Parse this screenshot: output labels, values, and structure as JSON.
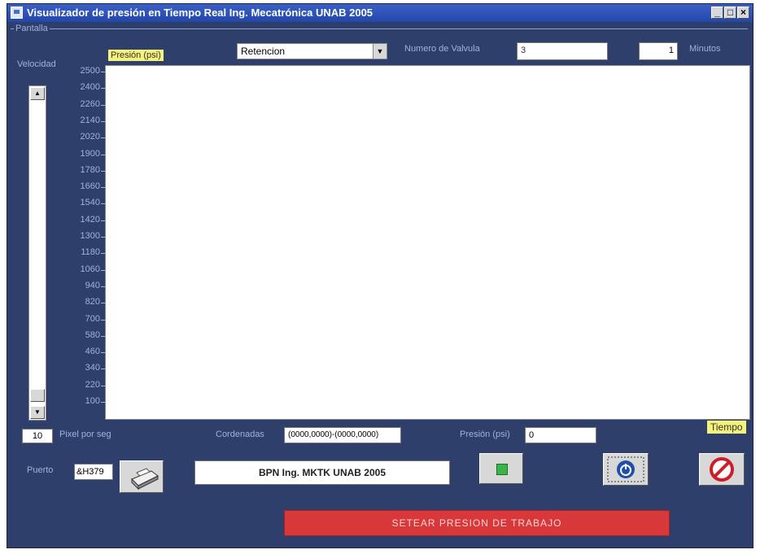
{
  "window": {
    "title": "Visualizador de presión en Tiempo Real Ing. Mecatrónica UNAB 2005",
    "frame_label": "Pantalla"
  },
  "controls": {
    "valve_type": "Retencion",
    "valve_number_label": "Numero de Valvula",
    "valve_number_value": "3",
    "minutes_value": "1",
    "minutes_label": "Minutos"
  },
  "left_panel": {
    "speed_label": "Velocidad",
    "pixel_value": "10",
    "pixel_label": "Pixel por seg"
  },
  "chart_data": {
    "type": "line",
    "ylabel": "Presión (psi)",
    "xlabel": "Tiempo",
    "yticks": [
      "2500",
      "2400",
      "2260",
      "2140",
      "2020",
      "1900",
      "1780",
      "1660",
      "1540",
      "1420",
      "1300",
      "1180",
      "1060",
      "940",
      "820",
      "700",
      "580",
      "460",
      "340",
      "220",
      "100"
    ],
    "series": []
  },
  "readouts": {
    "coords_label": "Cordenadas",
    "coords_value": "(0000,0000)-(0000,0000)",
    "pressure_label": "Presión (psi)",
    "pressure_value": "0"
  },
  "bottom": {
    "port_label": "Puerto",
    "port_value": "&H379",
    "status_text": "BPN Ing. MKTK UNAB 2005",
    "set_button_label": "SETEAR PRESION DE TRABAJO"
  },
  "colors": {
    "background": "#2e3f6b",
    "accent_red": "#d9383a",
    "tag_yellow": "#f4f27a"
  }
}
